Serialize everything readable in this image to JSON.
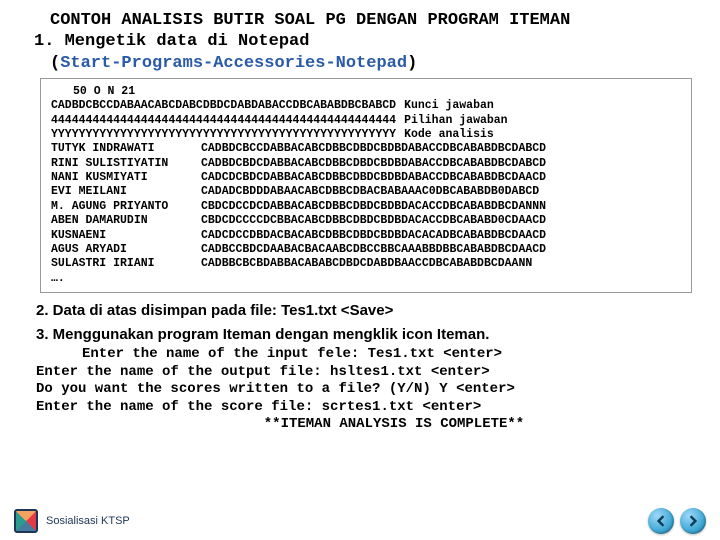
{
  "title": {
    "line1": "CONTOH ANALISIS BUTIR SOAL PG DENGAN PROGRAM ITEMAN",
    "line2": "1. Mengetik data di Notepad",
    "line3_prefix": "(",
    "line3_path": "Start-Programs-Accessories-Notepad",
    "line3_suffix": ")"
  },
  "code": {
    "header": "50 O N 21",
    "key_line": "CADBDCBCCDABAACABCDABCDBDCDABDABACCDBCABABDBCBABCD",
    "key_label": "Kunci jawaban",
    "opt_line": "44444444444444444444444444444444444444444444444444",
    "opt_label": "Pilihan jawaban",
    "ana_line": "YYYYYYYYYYYYYYYYYYYYYYYYYYYYYYYYYYYYYYYYYYYYYYYYYY",
    "ana_label": "Kode analisis",
    "rows": [
      {
        "name": "TUTYK INDRAWATI",
        "data": "CADBDCBCCDABBACABCDBBCDBDCBDBDABACCDBCABABDBCDABCD"
      },
      {
        "name": "RINI SULISTIYATIN",
        "data": "CADBDCBDCDABBACABCDBBCDBDCBDBDABACCDBCABABDBCDABCD"
      },
      {
        "name": "NANI KUSMIYATI",
        "data": "CADCDCBDCDABBACABCDBBCDBDCBDBDABACCDBCABABDBCDAACD"
      },
      {
        "name": "EVI MEILANI",
        "data": "CADADCBDDDABAACABCDBBCDBACBABAAAC0DBCABABDB0DABCD"
      },
      {
        "name": "M. AGUNG PRIYANTO",
        "data": "CBDCDCCDCDABBACABCDBBCDBDCBDBDACACCDBCABABDBCDANNN"
      },
      {
        "name": "ABEN DAMARUDIN",
        "data": "CBDCDCCCCDCBBACABCDBBCDBDCBDBDACACCDBCABABD0CDAACD"
      },
      {
        "name": "KUSNAENI",
        "data": "CADCDCCDBDACBACABCDBBCDBDCBDBDACACADBCABABDBCDAACD"
      },
      {
        "name": "AGUS ARYADI",
        "data": "CADBCCBDCDAABACBACAABCDBCCBBCAAABBDBBCABABDBCDAACD"
      },
      {
        "name": "SULASTRI IRIANI",
        "data": "CADBBCBCBDABBACABABCDBDCDABDBAACCDBCABABDBCDAANN"
      }
    ],
    "ellipsis": "…."
  },
  "steps": {
    "s2": "2. Data di atas disimpan pada file: Tes1.txt <Save>",
    "s3": "3. Menggunakan program Iteman dengan mengklik icon Iteman."
  },
  "run": {
    "l1": "Enter the name of the input fele: Tes1.txt  <enter>",
    "l2": "Enter the name of the output file: hsltes1.txt  <enter>",
    "l3": "Do you want the scores written to a file? (Y/N) Y  <enter>",
    "l4": "Enter the name of the score file: scrtes1.txt  <enter>",
    "done": "**ITEMAN ANALYSIS IS COMPLETE**"
  },
  "footer": {
    "text": "Sosialisasi KTSP"
  }
}
